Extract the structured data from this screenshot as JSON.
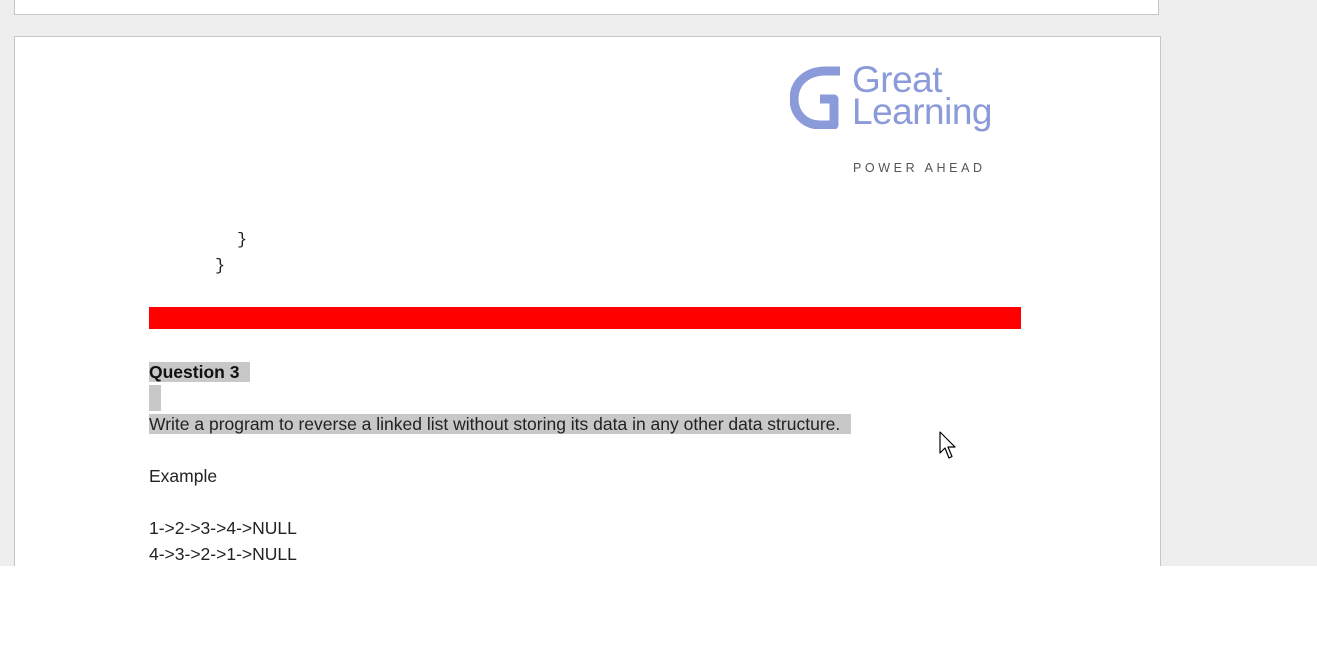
{
  "document": {
    "logo": {
      "word_line1": "Great",
      "word_line2": "Learning",
      "tagline": "POWER AHEAD",
      "icon": "great-learning-g-logo-icon",
      "color": "#8b9ad8"
    },
    "code_lines": [
      "}",
      "}"
    ],
    "divider_color": "#ff0000",
    "question": {
      "title": "Question 3",
      "body": "Write a program to reverse a linked list without storing its data in any other data structure.",
      "highlight_color": "#c8c8c8"
    },
    "example": {
      "label": "Example",
      "lines": [
        "1->2->3->4->NULL",
        "4->3->2->1->NULL"
      ]
    }
  },
  "pointer": {
    "icon": "mouse-cursor-icon"
  }
}
